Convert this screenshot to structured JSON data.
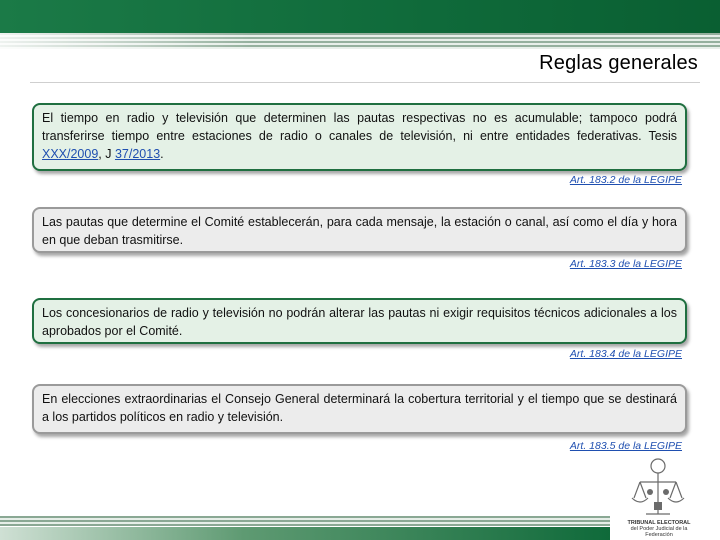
{
  "header": {
    "title": "Reglas generales"
  },
  "rules": [
    {
      "text_before": "El tiempo en radio y televisión que determinen las pautas respectivas no es acumulable; tampoco podrá transferirse tiempo entre estaciones de radio o canales de televisión, ni entre entidades federativas. Tesis ",
      "link1": "XXX/2009",
      "text_mid": ", J ",
      "link2": "37/2013",
      "text_after": ".",
      "reference": "Art. 183.2 de la LEGIPE"
    },
    {
      "text": "Las pautas que determine el Comité establecerán, para cada mensaje, la estación o canal, así como el día y hora en que deban trasmitirse.",
      "reference": "Art. 183.3 de la LEGIPE"
    },
    {
      "text": "Los concesionarios de radio y televisión no podrán alterar las pautas ni exigir requisitos técnicos adicionales a los aprobados por el Comité.",
      "reference": "Art. 183.4 de la LEGIPE"
    },
    {
      "text": "En elecciones extraordinarias el Consejo General determinará la cobertura territorial y el tiempo que se destinará a los partidos políticos en radio y televisión.",
      "reference": "Art. 183.5 de la LEGIPE"
    }
  ],
  "logo": {
    "icon": "tribunal-electoral-logo",
    "text_line1": "TRIBUNAL ELECTORAL",
    "text_line2": "del Poder Judicial de la Federación"
  },
  "colors": {
    "brand_green": "#0f6a3a",
    "box_green_bg": "#e4f1e6",
    "box_gray_bg": "#ececec",
    "link_blue": "#1f4fb0"
  }
}
